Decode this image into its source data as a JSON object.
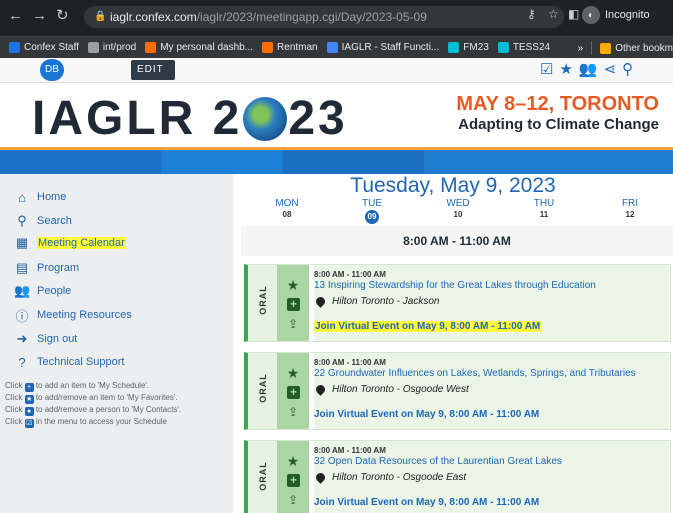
{
  "browser": {
    "url_host": "iaglr.confex.com",
    "url_path": "/iaglr/2023/meetingapp.cgi/Day/2023-05-09",
    "incognito_label": "Incognito",
    "bookmarks": [
      {
        "label": "Confex Staff",
        "icon": "confex-icon",
        "color": "#1a73e8"
      },
      {
        "label": "int/prod",
        "icon": "globe-icon",
        "color": "#9aa0a6"
      },
      {
        "label": "My personal dashb...",
        "icon": "dashboard-icon",
        "color": "#ff6d00"
      },
      {
        "label": "Rentman",
        "icon": "rentman-icon",
        "color": "#ff6d00"
      },
      {
        "label": "IAGLR - Staff Functi...",
        "icon": "iaglr-icon",
        "color": "#4285f4"
      },
      {
        "label": "FM23",
        "icon": "wave-icon",
        "color": "#00bcd4"
      },
      {
        "label": "TESS24",
        "icon": "wave-icon",
        "color": "#00bcd4"
      }
    ],
    "bookmarks_more": "»",
    "other_bookmarks": "Other bookm"
  },
  "site": {
    "avatar_initials": "DB",
    "edit_label": "EDIT",
    "logo_left": "IAGLR 2",
    "logo_right": "23",
    "conf_date": "MAY 8–12, TORONTO",
    "conf_theme": "Adapting to Climate Change"
  },
  "sidebar": {
    "items": [
      {
        "label": "Home",
        "icon": "home-icon",
        "glyph": "⌂"
      },
      {
        "label": "Search",
        "icon": "search-icon",
        "glyph": "⚲"
      },
      {
        "label": "Meeting Calendar",
        "icon": "calendar-icon",
        "glyph": "▦",
        "highlighted": true
      },
      {
        "label": "Program",
        "icon": "program-icon",
        "glyph": "▤"
      },
      {
        "label": "People",
        "icon": "people-icon",
        "glyph": "👥"
      },
      {
        "label": "Meeting Resources",
        "icon": "info-icon",
        "glyph": "ⓘ"
      },
      {
        "label": "Sign out",
        "icon": "sign-out-icon",
        "glyph": "➜"
      },
      {
        "label": "Technical Support",
        "icon": "question-icon",
        "glyph": "?"
      }
    ],
    "help": [
      {
        "pre": "Click",
        "post": "to add an item to 'My Schedule'."
      },
      {
        "pre": "Click",
        "post": "to add/remove an item to 'My Favorites'."
      },
      {
        "pre": "Click",
        "post": "to add/remove a person to 'My Contacts'."
      },
      {
        "pre": "Click",
        "post": "in the menu to access your Schedule"
      }
    ]
  },
  "day": {
    "title": "Tuesday, May 9, 2023",
    "days": [
      {
        "dow": "MON",
        "num": "08",
        "active": false
      },
      {
        "dow": "TUE",
        "num": "09",
        "active": true
      },
      {
        "dow": "WED",
        "num": "10",
        "active": false
      },
      {
        "dow": "THU",
        "num": "11",
        "active": false
      },
      {
        "dow": "FRI",
        "num": "12",
        "active": false
      }
    ],
    "slot": "8:00 AM - 11:00 AM"
  },
  "sessions": [
    {
      "type": "ORAL",
      "time": "8:00 AM - 11:00 AM",
      "title": "13 Inspiring Stewardship for the Great Lakes through Education",
      "location": "Hilton Toronto - Jackson",
      "link": "Join Virtual Event on May 9, 8:00 AM - 11:00 AM",
      "link_highlighted": true
    },
    {
      "type": "ORAL",
      "time": "8:00 AM - 11:00 AM",
      "title": "22 Groundwater Influences on Lakes, Wetlands, Springs, and Tributaries",
      "location": "Hilton Toronto - Osgoode West",
      "link": "Join Virtual Event on May 9, 8:00 AM - 11:00 AM",
      "link_highlighted": false
    },
    {
      "type": "ORAL",
      "time": "8:00 AM - 11:00 AM",
      "title": "32 Open Data Resources of the Laurentian Great Lakes",
      "location": "Hilton Toronto - Osgoode East",
      "link": "Join Virtual Event on May 9, 8:00 AM - 11:00 AM",
      "link_highlighted": false
    }
  ],
  "colors": {
    "link_blue": "#1f66b3",
    "accent_orange": "#e85a24",
    "highlight_yellow": "#fffb3a",
    "session_green": "#3aa851"
  }
}
